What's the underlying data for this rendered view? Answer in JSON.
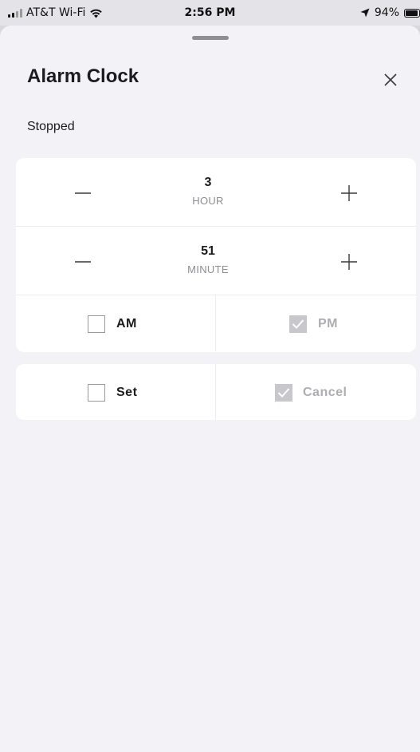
{
  "status_bar": {
    "carrier": "AT&T Wi-Fi",
    "time": "2:56 PM",
    "battery": "94%",
    "battery_level": 0.94
  },
  "sheet": {
    "title": "Alarm Clock",
    "status": "Stopped"
  },
  "time_setting": {
    "hour": {
      "value": "3",
      "label": "HOUR"
    },
    "minute": {
      "value": "51",
      "label": "MINUTE"
    },
    "am": {
      "label": "AM",
      "checked": false
    },
    "pm": {
      "label": "PM",
      "checked": true
    }
  },
  "actions": {
    "set": {
      "label": "Set",
      "checked": false
    },
    "cancel": {
      "label": "Cancel",
      "checked": true
    }
  },
  "icons": {
    "close": "close-icon",
    "minus": "minus-icon",
    "plus": "plus-icon",
    "check": "checkmark-icon",
    "wifi": "wifi-icon",
    "location": "location-arrow-icon",
    "battery": "battery-icon",
    "signal": "signal-bars-icon"
  },
  "colors": {
    "sheet_bg": "#f2f2f7",
    "card_bg": "#ffffff",
    "text": "#1c1c1e",
    "muted": "#8e8e93",
    "checked_box": "#c8c8cc"
  }
}
